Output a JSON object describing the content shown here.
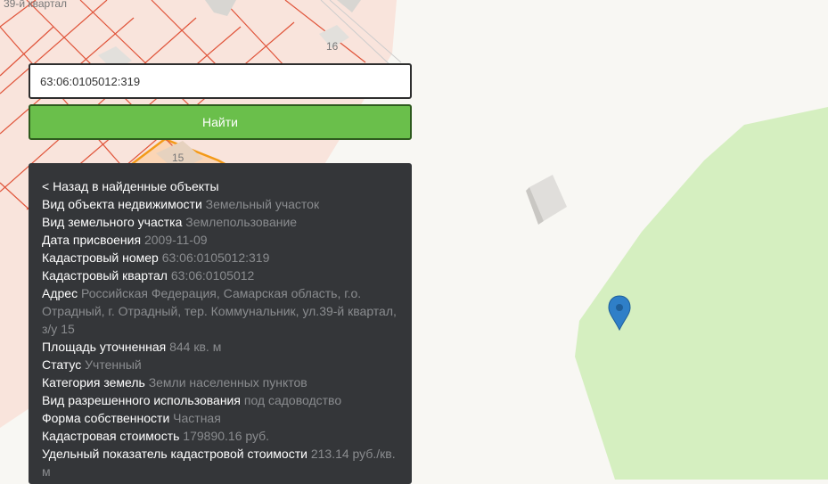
{
  "map": {
    "quarter_label": "39-й квартал",
    "plot_labels": [
      "16",
      "15"
    ],
    "marker": "map-pin-icon"
  },
  "search": {
    "value": "63:06:0105012:319",
    "button_label": "Найти"
  },
  "info": {
    "back_label": "< Назад в найденные объекты",
    "fields": [
      {
        "label": "Вид объекта недвижимости",
        "value": "Земельный участок"
      },
      {
        "label": "Вид земельного участка",
        "value": "Землепользование"
      },
      {
        "label": "Дата присвоения",
        "value": "2009-11-09"
      },
      {
        "label": "Кадастровый номер",
        "value": "63:06:0105012:319"
      },
      {
        "label": "Кадастровый квартал",
        "value": "63:06:0105012"
      },
      {
        "label": "Адрес",
        "value": "Российская Федерация, Самарская область, г.о. Отрадный, г. Отрадный, тер. Коммунальник, ул.39-й квартал, з/у 15"
      },
      {
        "label": "Площадь уточненная",
        "value": "844 кв. м"
      },
      {
        "label": "Статус",
        "value": "Учтенный"
      },
      {
        "label": "Категория земель",
        "value": "Земли населенных пунктов"
      },
      {
        "label": "Вид разрешенного использования",
        "value": "под садоводство"
      },
      {
        "label": "Форма собственности",
        "value": "Частная"
      },
      {
        "label": "Кадастровая стоимость",
        "value": "179890.16 руб."
      },
      {
        "label": "Удельный показатель кадастровой стоимости",
        "value": "213.14 руб./кв. м"
      }
    ]
  },
  "colors": {
    "parcel_fill": "#f9e4dc",
    "parcel_line": "#e0543a",
    "selected_line": "#f39a18",
    "park": "#d5efc0",
    "button": "#6abf4b",
    "panel": "#343639",
    "marker": "#2f7fc8"
  }
}
